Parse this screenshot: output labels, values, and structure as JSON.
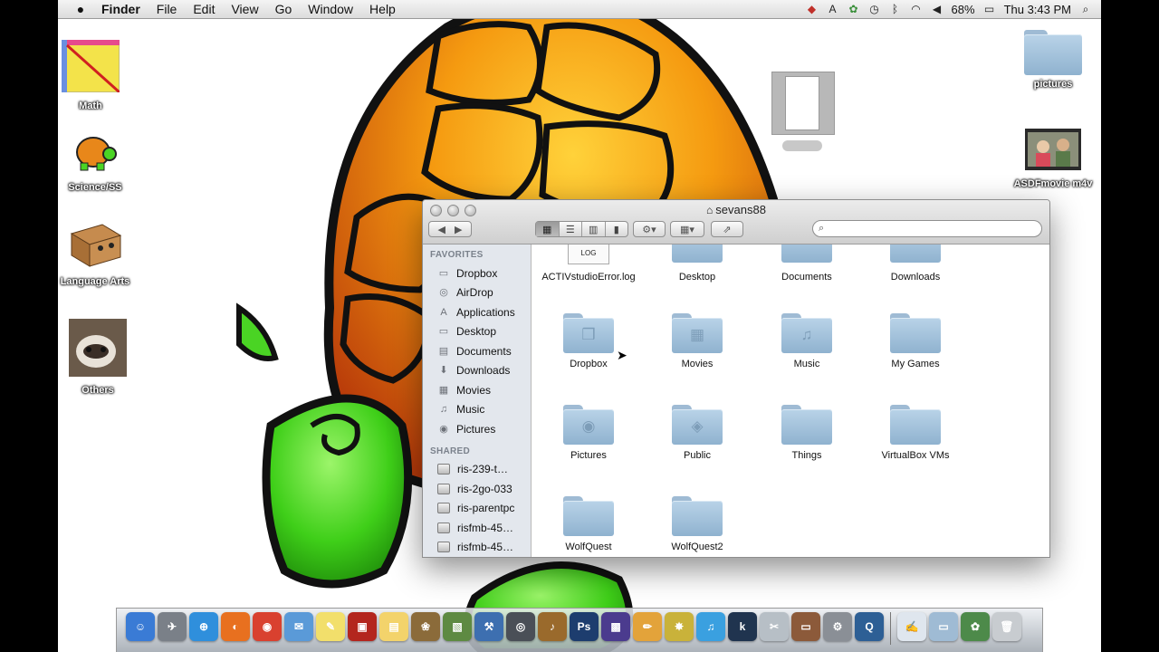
{
  "menubar": {
    "app_name": "Finder",
    "menus": [
      "File",
      "Edit",
      "View",
      "Go",
      "Window",
      "Help"
    ],
    "battery": "68%",
    "clock": "Thu 3:43 PM",
    "status_icons": [
      "dropbox-icon",
      "adobe-icon",
      "sync-icon",
      "time-machine-icon",
      "bluetooth-icon",
      "wifi-icon",
      "volume-icon",
      "battery-icon",
      "spotlight-icon"
    ]
  },
  "desktop": {
    "left_icons": [
      {
        "label": "Math"
      },
      {
        "label": "Science/SS"
      },
      {
        "label": "Language Arts"
      },
      {
        "label": "Others"
      }
    ],
    "right_icons": [
      {
        "label": "pictures"
      },
      {
        "label": "ASDFmovie m4v"
      }
    ]
  },
  "finder": {
    "title": "sevans88",
    "search_placeholder": "",
    "sidebar": {
      "favorites_header": "FAVORITES",
      "favorites": [
        {
          "label": "Dropbox",
          "icon": "folder-icon"
        },
        {
          "label": "AirDrop",
          "icon": "airdrop-icon"
        },
        {
          "label": "Applications",
          "icon": "applications-icon"
        },
        {
          "label": "Desktop",
          "icon": "desktop-icon"
        },
        {
          "label": "Documents",
          "icon": "documents-icon"
        },
        {
          "label": "Downloads",
          "icon": "downloads-icon"
        },
        {
          "label": "Movies",
          "icon": "movies-icon"
        },
        {
          "label": "Music",
          "icon": "music-icon"
        },
        {
          "label": "Pictures",
          "icon": "pictures-icon"
        }
      ],
      "shared_header": "SHARED",
      "shared": [
        {
          "label": "ris-239-t…"
        },
        {
          "label": "ris-2go-033"
        },
        {
          "label": "ris-parentpc"
        },
        {
          "label": "risfmb-45…"
        },
        {
          "label": "risfmb-45…"
        }
      ]
    },
    "items": [
      {
        "name": "ACTIVstudioError.log",
        "kind": "log",
        "badge": "LOG"
      },
      {
        "name": "Desktop",
        "kind": "folder"
      },
      {
        "name": "Documents",
        "kind": "folder"
      },
      {
        "name": "Downloads",
        "kind": "folder"
      },
      {
        "name": "Dropbox",
        "kind": "folder",
        "emblem": "❒"
      },
      {
        "name": "Movies",
        "kind": "folder",
        "emblem": "▦"
      },
      {
        "name": "Music",
        "kind": "folder",
        "emblem": "♫"
      },
      {
        "name": "My Games",
        "kind": "folder"
      },
      {
        "name": "Pictures",
        "kind": "folder",
        "emblem": "◉"
      },
      {
        "name": "Public",
        "kind": "folder",
        "emblem": "◈"
      },
      {
        "name": "Things",
        "kind": "folder"
      },
      {
        "name": "VirtualBox VMs",
        "kind": "folder"
      },
      {
        "name": "WolfQuest",
        "kind": "folder"
      },
      {
        "name": "WolfQuest2",
        "kind": "folder"
      }
    ]
  },
  "dock": {
    "apps": [
      {
        "icon": "finder-icon",
        "color": "#3a7bd5",
        "glyph": "☺"
      },
      {
        "icon": "launchpad-icon",
        "color": "#7a8088",
        "glyph": "✈"
      },
      {
        "icon": "safari-icon",
        "color": "#2f8fdc",
        "glyph": "⊕"
      },
      {
        "icon": "firefox-icon",
        "color": "#e8701f",
        "glyph": "◐"
      },
      {
        "icon": "chrome-icon",
        "color": "#d9412f",
        "glyph": "◉"
      },
      {
        "icon": "mail-icon",
        "color": "#5a9ad8",
        "glyph": "✉"
      },
      {
        "icon": "notes-icon",
        "color": "#f2df6b",
        "glyph": "✎"
      },
      {
        "icon": "photo-booth-icon",
        "color": "#b3261e",
        "glyph": "▣"
      },
      {
        "icon": "stickies-icon",
        "color": "#f3d36b",
        "glyph": "▤"
      },
      {
        "icon": "iphoto-icon",
        "color": "#8b6b3a",
        "glyph": "❀"
      },
      {
        "icon": "app-store-icon",
        "color": "#5e8a42",
        "glyph": "▧"
      },
      {
        "icon": "system-tool-icon",
        "color": "#3d6fb0",
        "glyph": "⚒"
      },
      {
        "icon": "facetime-icon",
        "color": "#4a4f57",
        "glyph": "◎"
      },
      {
        "icon": "garageband-icon",
        "color": "#9a6a2c",
        "glyph": "♪"
      },
      {
        "icon": "photoshop-icon",
        "color": "#1d3d6e",
        "glyph": "Ps"
      },
      {
        "icon": "imovie-icon",
        "color": "#4b3b8e",
        "glyph": "▩"
      },
      {
        "icon": "pages-icon",
        "color": "#e3a33a",
        "glyph": "✏"
      },
      {
        "icon": "comic-life-icon",
        "color": "#c9b23a",
        "glyph": "✸"
      },
      {
        "icon": "itunes-icon",
        "color": "#3aa0e0",
        "glyph": "♫"
      },
      {
        "icon": "kindle-icon",
        "color": "#20344f",
        "glyph": "k"
      },
      {
        "icon": "preview-icon",
        "color": "#b7bfc6",
        "glyph": "✂"
      },
      {
        "icon": "presentation-icon",
        "color": "#8c5a3a",
        "glyph": "▭"
      },
      {
        "icon": "system-preferences-icon",
        "color": "#8a8f96",
        "glyph": "⚙"
      },
      {
        "icon": "quicktime-icon",
        "color": "#2d5f95",
        "glyph": "Q"
      }
    ],
    "stacks": [
      {
        "icon": "document-stack-icon",
        "color": "#dfe6ee",
        "glyph": "✍"
      },
      {
        "icon": "applications-stack-icon",
        "color": "#9fbbd4",
        "glyph": "▭"
      },
      {
        "icon": "downloads-stack-icon",
        "color": "#4d8a4a",
        "glyph": "✿"
      },
      {
        "icon": "trash-icon",
        "color": "#c8ccd0",
        "glyph": "🗑"
      }
    ]
  }
}
